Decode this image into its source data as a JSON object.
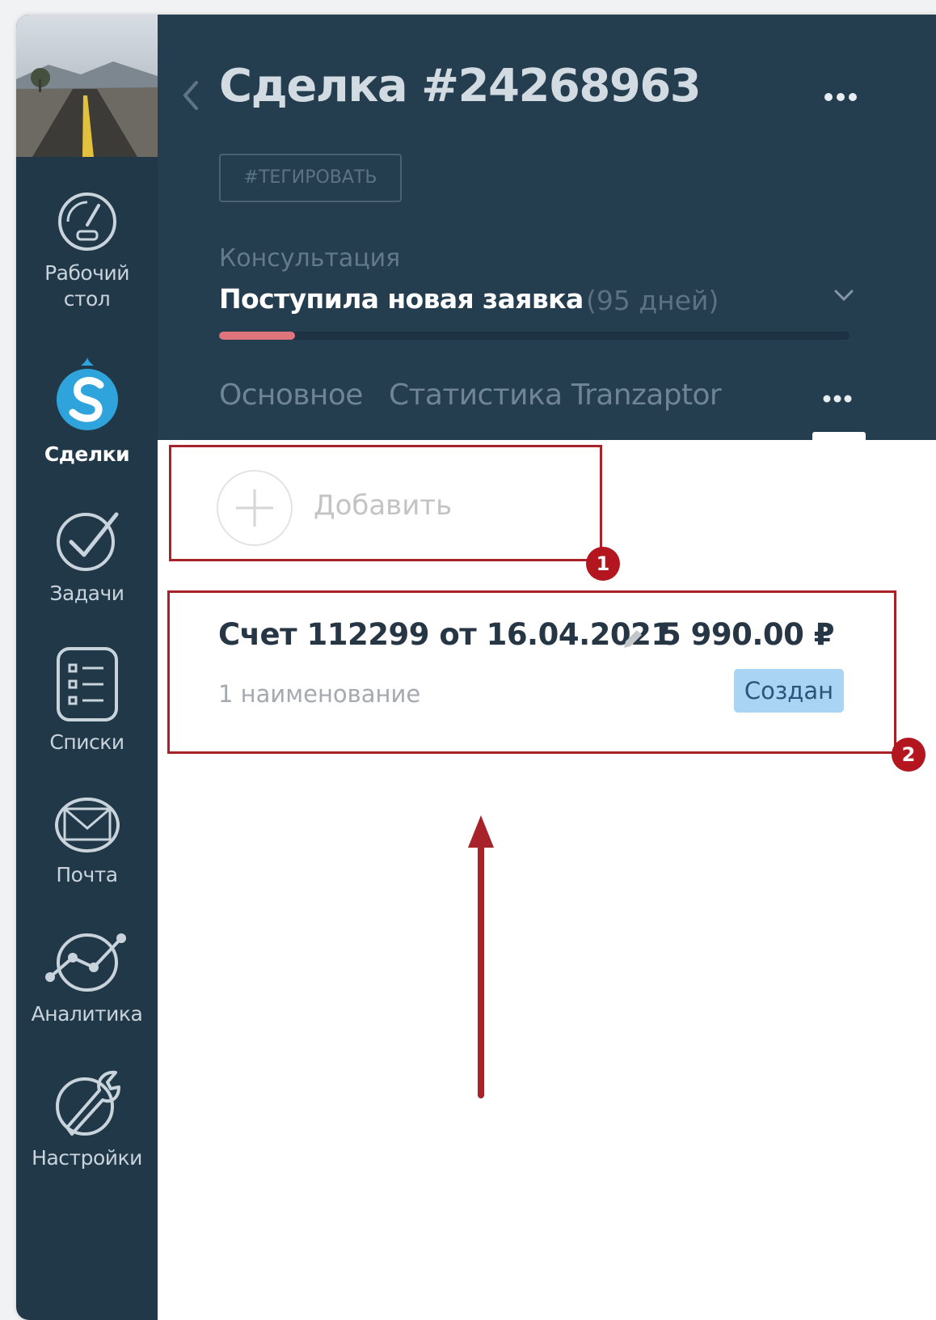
{
  "sidebar": {
    "items": [
      {
        "label": "Рабочий\nстол",
        "icon": "speedometer-icon"
      },
      {
        "label": "Сделки",
        "icon": "deals-logo-icon",
        "active": true
      },
      {
        "label": "Задачи",
        "icon": "checkmark-circle-icon"
      },
      {
        "label": "Списки",
        "icon": "list-icon"
      },
      {
        "label": "Почта",
        "icon": "mail-icon"
      },
      {
        "label": "Аналитика",
        "icon": "analytics-icon"
      },
      {
        "label": "Настройки",
        "icon": "wrench-icon"
      }
    ]
  },
  "header": {
    "title": "Сделка #24268963",
    "tag_button": "#ТЕГИРОВАТЬ",
    "pipeline": "Консультация",
    "stage": "Поступила новая заявка",
    "stage_days": "(95 дней)",
    "stage_progress": 0.12,
    "tabs": [
      "Основное",
      "Статистика",
      "Tranzaptor"
    ]
  },
  "content": {
    "add_label": "Добавить",
    "marker_1": "1",
    "marker_2": "2",
    "invoice": {
      "title": "Счет 112299 от 16.04.2021",
      "sum": "5 990.00 ₽",
      "items": "1 наименование",
      "status": "Создан"
    }
  },
  "colors": {
    "sidebar_bg": "#213849",
    "header_bg": "#243d4f",
    "progress": "#e0747d",
    "annotation_red": "#a8222a",
    "status_badge": "#a9d4f3"
  }
}
